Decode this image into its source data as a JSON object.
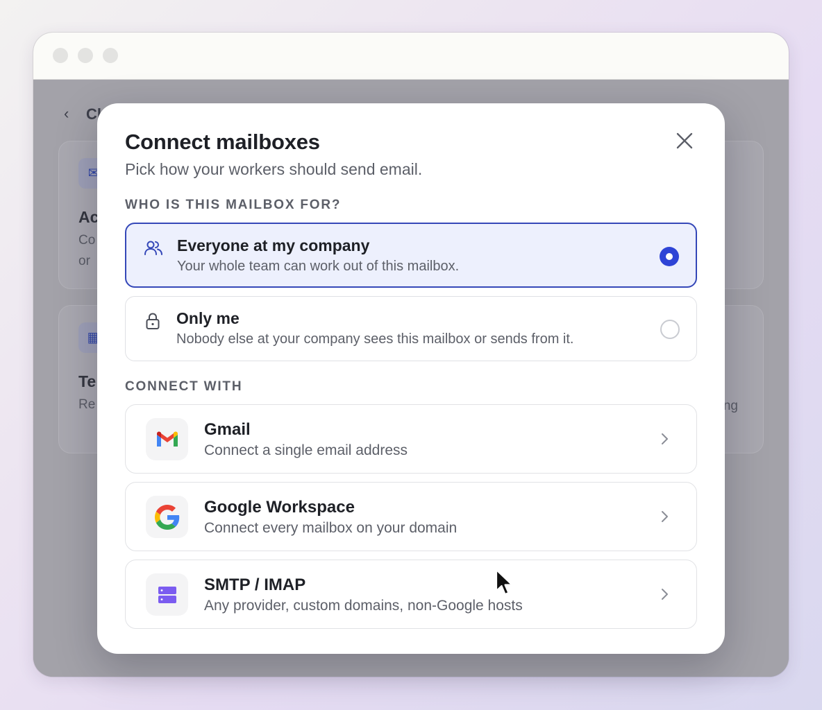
{
  "background_page": {
    "back_title": "Cl",
    "cards": [
      {
        "heading": "Ac",
        "lines": [
          "Co",
          "or"
        ]
      },
      {
        "heading": "Te",
        "lines": [
          "Re"
        ],
        "right_text": "ng"
      }
    ]
  },
  "modal": {
    "title": "Connect mailboxes",
    "subtitle": "Pick how your workers should send email.",
    "audience_section_label": "WHO IS THIS MAILBOX FOR?",
    "audience_options": [
      {
        "title": "Everyone at my company",
        "description": "Your whole team can work out of this mailbox.",
        "icon": "users-icon",
        "selected": true
      },
      {
        "title": "Only me",
        "description": "Nobody else at your company sees this mailbox or sends from it.",
        "icon": "lock-icon",
        "selected": false
      }
    ],
    "connect_section_label": "CONNECT WITH",
    "providers": [
      {
        "title": "Gmail",
        "description": "Connect a single email address",
        "icon": "gmail-logo-icon"
      },
      {
        "title": "Google Workspace",
        "description": "Connect every mailbox on your domain",
        "icon": "google-logo-icon"
      },
      {
        "title": "SMTP / IMAP",
        "description": "Any provider, custom domains, non-Google hosts",
        "icon": "server-icon"
      }
    ]
  },
  "colors": {
    "accent": "#2e44d6",
    "selected_bg": "#edf0fd",
    "server_purple": "#7b5cf0"
  }
}
